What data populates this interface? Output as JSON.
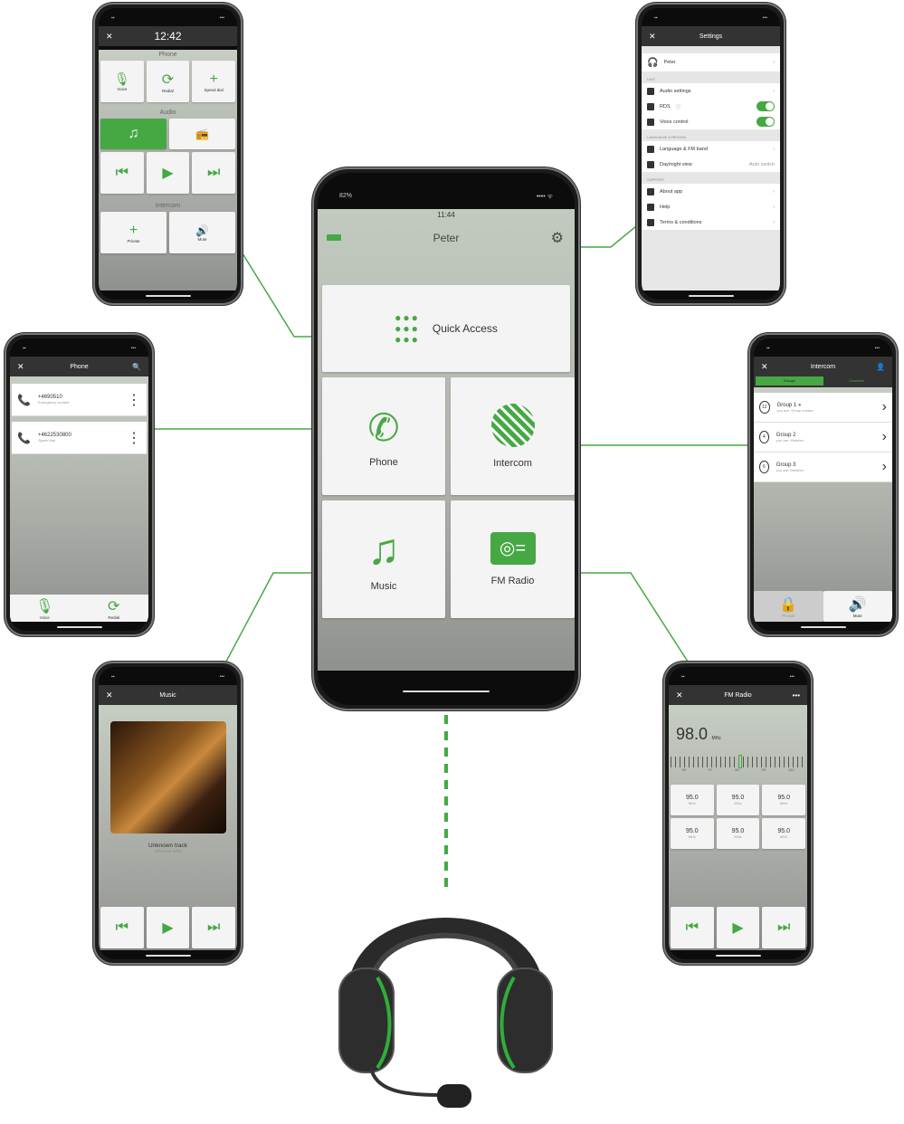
{
  "accent": "#46a843",
  "center": {
    "time": "11:44",
    "battery": "82%",
    "user": "Peter",
    "tiles": {
      "quick": "Quick Access",
      "phone": "Phone",
      "intercom": "Intercom",
      "music": "Music",
      "radio": "FM Radio"
    },
    "icons": [
      "battery-icon",
      "gear-icon",
      "grid-icon",
      "phone-icon",
      "intercom-logo-icon",
      "music-note-icon",
      "radio-icon"
    ]
  },
  "quickpanel": {
    "time": "12:42",
    "phone_section": "Phone",
    "voice": "Voice",
    "redial": "Redial",
    "speed_dial": "Speed dial",
    "audio_section": "Audio",
    "intercom_section": "Intercom",
    "private": "Private",
    "mute": "Mute"
  },
  "settings": {
    "title": "Settings",
    "user": "Peter",
    "unit_header": "UNIT",
    "audio": "Audio settings",
    "rds": "RDS",
    "voice": "Voice control",
    "rds_on": true,
    "voice_on": true,
    "lang_header": "LANGUAGE & REGION",
    "language": "Language & FM band",
    "daynight": "Day/night view",
    "daynight_value": "Auto switch",
    "support_header": "SUPPORT",
    "about": "About app",
    "help": "Help",
    "terms": "Terms & conditions"
  },
  "phone": {
    "title": "Phone",
    "contacts": [
      {
        "number": "+4690510",
        "label": "Emergency contact"
      },
      {
        "number": "+4622530800",
        "label": "Speed dial"
      }
    ],
    "voice": "Voice",
    "redial": "Redial"
  },
  "intercom": {
    "title": "Intercom",
    "tab_groups": "Groups",
    "tab_channels": "Channels",
    "groups": [
      {
        "name": "Group 1",
        "role_label": "you are:",
        "role": "Group creator",
        "count": "12"
      },
      {
        "name": "Group 2",
        "role_label": "you are:",
        "role": "Member",
        "count": "4"
      },
      {
        "name": "Group 3",
        "role_label": "you are:",
        "role": "Member",
        "count": "6"
      }
    ],
    "private": "Private",
    "mute": "Mute"
  },
  "music": {
    "title": "Music",
    "track": "Unknown track",
    "artist": "Unknown artist"
  },
  "radio": {
    "title": "FM Radio",
    "frequency": "98.0",
    "unit": "MHz",
    "ticks": [
      "96",
      "97",
      "98",
      "99",
      "100"
    ],
    "presets": [
      {
        "f": "95.0",
        "u": "MHz"
      },
      {
        "f": "95.0",
        "u": "MHz"
      },
      {
        "f": "95.0",
        "u": "MHz"
      },
      {
        "f": "95.0",
        "u": "MHz"
      },
      {
        "f": "95.0",
        "u": "MHz"
      },
      {
        "f": "95.0",
        "u": "MHz"
      }
    ]
  }
}
